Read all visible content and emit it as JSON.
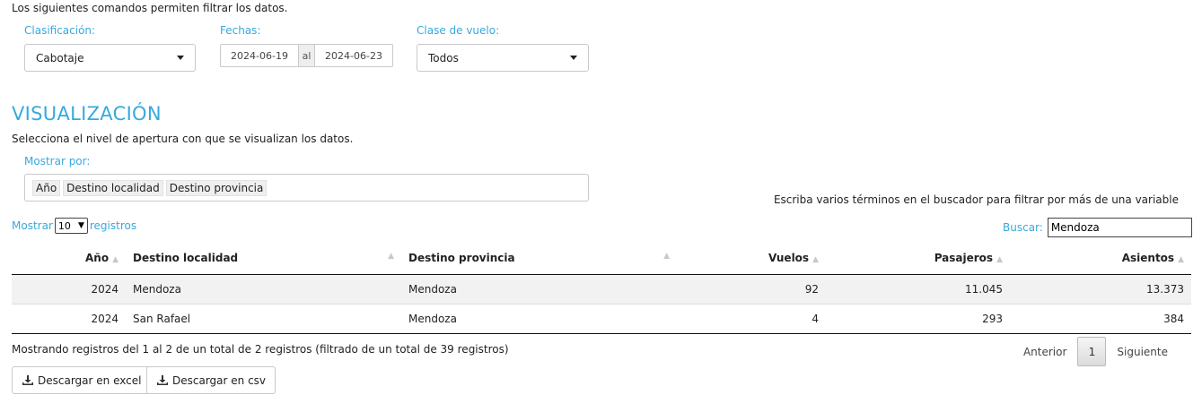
{
  "intro": "Los siguientes comandos permiten filtrar los datos.",
  "filters": {
    "clasificacion": {
      "label": "Clasificación:",
      "value": "Cabotaje"
    },
    "fechas": {
      "label": "Fechas:",
      "start": "2024-06-19",
      "sep": "al",
      "end": "2024-06-23"
    },
    "clase": {
      "label": "Clase de vuelo:",
      "value": "Todos"
    }
  },
  "viz": {
    "title": "VISUALIZACIÓN",
    "desc": "Selecciona el nivel de apertura con que se visualizan los datos.",
    "mostrar_label": "Mostrar por:",
    "chips": [
      "Año",
      "Destino localidad",
      "Destino provincia"
    ]
  },
  "help": "Escriba varios términos en el buscador para filtrar por más de una variable",
  "length": {
    "pre": "Mostrar",
    "value": "10",
    "post": "registros"
  },
  "search": {
    "label": "Buscar:",
    "value": "Mendoza"
  },
  "table": {
    "headers": [
      "Año",
      "Destino localidad",
      "Destino provincia",
      "Vuelos",
      "Pasajeros",
      "Asientos"
    ],
    "rows": [
      [
        "2024",
        "Mendoza",
        "Mendoza",
        "92",
        "11.045",
        "13.373"
      ],
      [
        "2024",
        "San Rafael",
        "Mendoza",
        "4",
        "293",
        "384"
      ]
    ]
  },
  "info": "Mostrando registros del 1 al 2 de un total de 2 registros (filtrado de un total de 39 registros)",
  "pager": {
    "prev": "Anterior",
    "current": "1",
    "next": "Siguiente"
  },
  "downloads": {
    "excel": "Descargar en excel",
    "csv": "Descargar en csv"
  },
  "colors": {
    "accent": "#37a9de"
  },
  "icons": {
    "sort": "sort-icon",
    "download": "download-icon",
    "dropdown": "chevron-down-icon"
  }
}
